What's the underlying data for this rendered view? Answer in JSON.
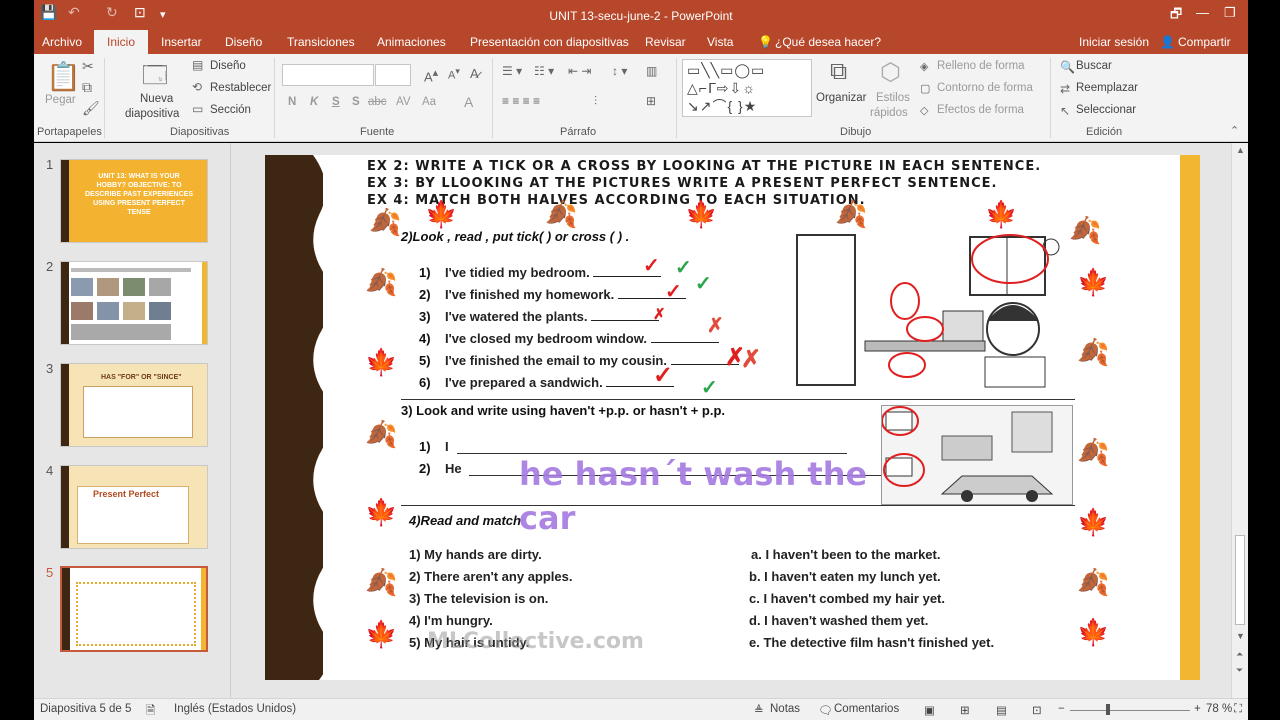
{
  "app": {
    "title": "UNIT 13-secu-june-2 - PowerPoint",
    "colors": {
      "accent": "#b7472a",
      "selected_thumb": "#c55a3c",
      "overlay_text": "#a57ae0"
    }
  },
  "quick_access": {
    "icons": [
      "save-icon",
      "undo-icon",
      "redo-icon",
      "start-presentation-icon",
      "customize-icon"
    ]
  },
  "window_controls": {
    "restore": "🗗",
    "minimize": "—",
    "maximize": "❐",
    "close": "✕"
  },
  "menu": {
    "tabs": [
      "Archivo",
      "Inicio",
      "Insertar",
      "Diseño",
      "Transiciones",
      "Animaciones",
      "Presentación con diapositivas",
      "Revisar",
      "Vista"
    ],
    "active_tab": "Inicio",
    "tell_me": "¿Qué desea hacer?",
    "signin": "Iniciar sesión",
    "share": "Compartir"
  },
  "ribbon": {
    "portapapeles": {
      "paste": "Pegar",
      "group": "Portapapeles"
    },
    "diapositivas": {
      "new_slide_1": "Nueva",
      "new_slide_2": "diapositiva",
      "layout": "Diseño",
      "reset": "Restablecer",
      "section": "Sección",
      "group": "Diapositivas"
    },
    "fuente": {
      "group": "Fuente",
      "buttons": [
        "N",
        "K",
        "S",
        "S",
        "abc",
        "AV",
        "Aa",
        "A"
      ]
    },
    "parrafo": {
      "group": "Párrafo"
    },
    "dibujo": {
      "arrange": "Organizar",
      "quick_styles_1": "Estilos",
      "quick_styles_2": "rápidos",
      "fill": "Relleno de forma",
      "outline": "Contorno de forma",
      "effects": "Efectos de forma",
      "group": "Dibujo"
    },
    "edicion": {
      "find": "Buscar",
      "replace": "Reemplazar",
      "select": "Seleccionar",
      "group": "Edición"
    }
  },
  "slides_panel": {
    "numbers": [
      "1",
      "2",
      "3",
      "4",
      "5"
    ],
    "selected": "5",
    "thumb1_text": "UNIT 13: WHAT IS YOUR HOBBY? OBJECTIVE: TO DESCRIBE PAST EXPERIENCES USING PRESENT PERFECT TENSE",
    "thumb3_title": "HAS \"FOR\" OR \"SINCE\"",
    "thumb4_title": "Present Perfect"
  },
  "slide": {
    "ex_lines": [
      "EX 2: WRITE A TICK OR A CROSS BY LOOKING AT THE PICTURE IN EACH SENTENCE.",
      "EX 3: BY LLOOKING AT THE PICTURES WRITE A PRESENT PERFECT SENTENCE.",
      "EX 4: MATCH BOTH HALVES ACCORDING TO EACH SITUATION."
    ],
    "section2": {
      "heading": "2)Look , read , put tick(     ) or cross (     ) .",
      "items": [
        {
          "n": "1)",
          "text": "I've tidied my bedroom."
        },
        {
          "n": "2)",
          "text": "I've finished my homework."
        },
        {
          "n": "3)",
          "text": "I've watered the plants."
        },
        {
          "n": "4)",
          "text": "I've closed my bedroom window."
        },
        {
          "n": "5)",
          "text": "I've finished the email to my cousin."
        },
        {
          "n": "6)",
          "text": "I've prepared a sandwich."
        }
      ]
    },
    "section3": {
      "heading": "3) Look and write using haven't +p.p. or hasn't + p.p.",
      "lines": [
        {
          "n": "1)",
          "start": "I"
        },
        {
          "n": "2)",
          "start": "He"
        }
      ],
      "overlay_line1": "he hasn´t wash the",
      "overlay_line2": "car"
    },
    "section4": {
      "heading": "4)Read and match",
      "left": [
        "1) My hands are dirty.",
        "2) There aren't any apples.",
        "3) The television is on.",
        "4) I'm hungry.",
        "5) My hair is untidy."
      ],
      "right": [
        "a. I haven't been to the market.",
        "b. I haven't eaten my lunch yet.",
        "c. I haven't combed my hair yet.",
        "d. I haven't washed them yet.",
        "e. The detective film hasn't finished  yet."
      ]
    },
    "watermark": "MLCollective.com",
    "marks": {
      "tick": "✓",
      "cross": "✗"
    }
  },
  "status": {
    "slide_info": "Diapositiva 5 de 5",
    "language": "Inglés (Estados Unidos)",
    "notes": "Notas",
    "comments": "Comentarios",
    "zoom": "78 %"
  }
}
